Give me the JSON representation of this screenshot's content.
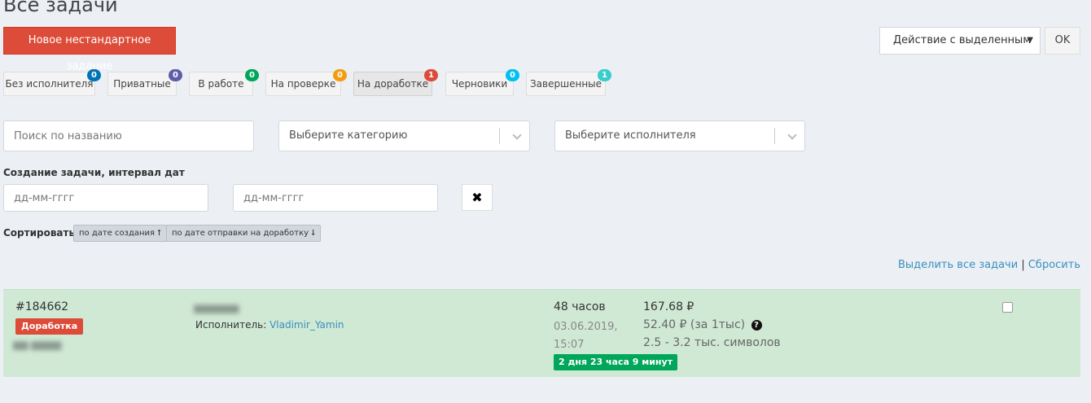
{
  "page": {
    "title": "Все задачи",
    "new_task_label": "Новое нестандартное задание"
  },
  "bulk_action": {
    "selected": "Действие с выделенным",
    "ok_label": "OK"
  },
  "tabs": [
    {
      "label": "Без исполнителя",
      "count": "0",
      "color": "#0073b7"
    },
    {
      "label": "Приватные",
      "count": "0",
      "color": "#605ca8"
    },
    {
      "label": "В работе",
      "count": "0",
      "color": "#00a65a"
    },
    {
      "label": "На проверке",
      "count": "0",
      "color": "#f39c12"
    },
    {
      "label": "На доработке",
      "count": "1",
      "color": "#dd4b39"
    },
    {
      "label": "Черновики",
      "count": "0",
      "color": "#00c0ef"
    },
    {
      "label": "Завершенные",
      "count": "1",
      "color": "#39cccc"
    }
  ],
  "filters": {
    "search_placeholder": "Поиск по названию",
    "category_placeholder": "Выберите категорию",
    "performer_placeholder": "Выберите исполнителя",
    "date_label": "Создание задачи, интервал дат",
    "date_from_placeholder": "дд-мм-гггг",
    "date_to_placeholder": "дд-мм-гггг",
    "clear_glyph": "✖"
  },
  "sort": {
    "label": "Сортировать:",
    "by_created": "по дате создания ⭡",
    "by_rework": "по дате отправки на доработку ⭣"
  },
  "selection": {
    "select_all": "Выделить все задачи",
    "separator": "|",
    "reset": "Сбросить"
  },
  "task": {
    "id": "#184662",
    "status": "Доработка",
    "performer_label": "Исполнитель:",
    "performer_name": "Vladimir_Yamin",
    "hours": "48 часов",
    "date": "03.06.2019,",
    "time": "15:07",
    "timer": "2 дня 23 часа 9 минут",
    "price": "167.68 ₽",
    "price_per": "52.40 ₽ (за 1тыс)",
    "chars": "2.5 - 3.2 тыс. символов",
    "help_glyph": "?",
    "selected": false
  },
  "colors": {
    "danger": "#dd4b39",
    "success": "#00a65a",
    "link": "#3c8dbc",
    "row_bg": "#d0e9d5"
  }
}
